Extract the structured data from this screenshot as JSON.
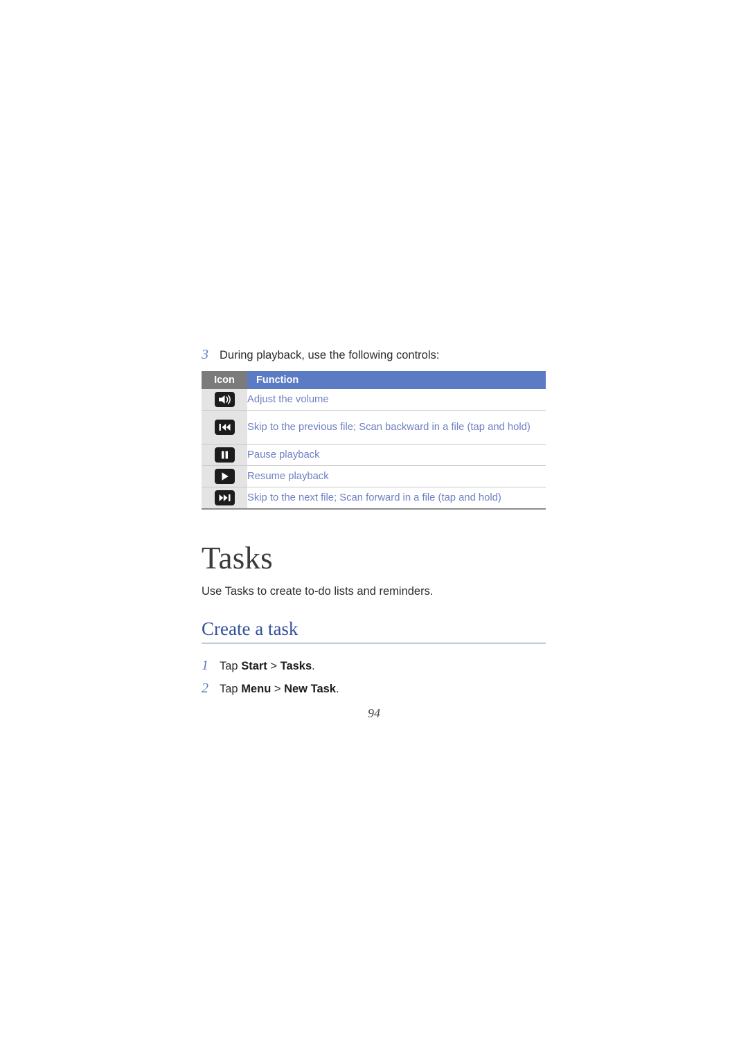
{
  "document": {
    "page_number": "94"
  },
  "playback_step": {
    "number": "3",
    "text": "During playback, use the following controls:"
  },
  "controls_table": {
    "headers": {
      "icon": "Icon",
      "function": "Function"
    },
    "rows": [
      {
        "icon_name": "volume-speaker-icon",
        "function": "Adjust the volume"
      },
      {
        "icon_name": "skip-previous-icon",
        "function": "Skip to the previous file; Scan backward in a file (tap and hold)"
      },
      {
        "icon_name": "pause-icon",
        "function": "Pause playback"
      },
      {
        "icon_name": "play-icon",
        "function": "Resume playback"
      },
      {
        "icon_name": "skip-next-icon",
        "function": "Skip to the next file; Scan forward in a file (tap and hold)"
      }
    ]
  },
  "tasks_section": {
    "heading": "Tasks",
    "intro": "Use Tasks to create to-do lists and reminders.",
    "subheading": "Create a task",
    "steps": [
      {
        "number": "1",
        "prefix": "Tap ",
        "bold1": "Start",
        "separator": " > ",
        "bold2": "Tasks",
        "suffix": "."
      },
      {
        "number": "2",
        "prefix": "Tap ",
        "bold1": "Menu",
        "separator": " > ",
        "bold2": "New Task",
        "suffix": "."
      }
    ]
  },
  "colors": {
    "header_blue": "#5b7bc4",
    "header_gray": "#7b7b7b",
    "link_blue": "#6f80c4",
    "heading_navy": "#33519b",
    "icon_cell_gray": "#e4e4e4"
  }
}
